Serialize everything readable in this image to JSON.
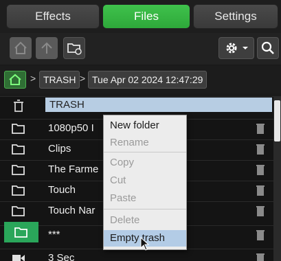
{
  "tabs": [
    {
      "label": "Effects",
      "active": false
    },
    {
      "label": "Files",
      "active": true
    },
    {
      "label": "Settings",
      "active": false
    }
  ],
  "toolbar": {
    "home_icon": "home-icon",
    "up_icon": "up-arrow-icon",
    "new_folder_icon": "new-folder-icon",
    "settings_icon": "gear-icon",
    "dropdown_icon": "chevron-down-icon",
    "search_icon": "search-icon"
  },
  "breadcrumb": {
    "separator": ">",
    "items": [
      "TRASH",
      "Tue Apr 02 2024 12:47:29"
    ]
  },
  "files": [
    {
      "name": "TRASH",
      "icon": "trash-icon",
      "selected": true
    },
    {
      "name": "1080p50 I",
      "icon": "folder-icon"
    },
    {
      "name": "Clips",
      "icon": "folder-icon"
    },
    {
      "name": "The Farme",
      "icon": "folder-icon"
    },
    {
      "name": "Touch",
      "icon": "folder-icon"
    },
    {
      "name": "Touch Nar",
      "icon": "folder-icon"
    },
    {
      "name": "***",
      "icon": "folder-icon"
    },
    {
      "name": "3 Sec",
      "icon": "clip-icon"
    }
  ],
  "context_menu": {
    "items": [
      {
        "label": "New folder",
        "enabled": true
      },
      {
        "label": "Rename",
        "enabled": false
      },
      {
        "label": "Copy",
        "enabled": false
      },
      {
        "label": "Cut",
        "enabled": false
      },
      {
        "label": "Paste",
        "enabled": false
      },
      {
        "label": "Delete",
        "enabled": false
      },
      {
        "label": "Empty trash",
        "enabled": true,
        "highlighted": true
      }
    ]
  },
  "colors": {
    "accent_green": "#3fc24c",
    "selection_blue": "#b7cde3"
  }
}
